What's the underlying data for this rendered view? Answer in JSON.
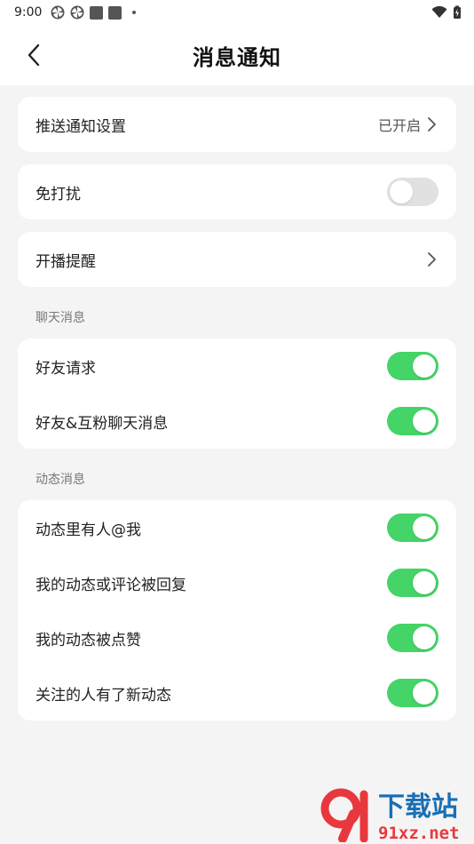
{
  "status_bar": {
    "time": "9:00"
  },
  "header": {
    "title": "消息通知"
  },
  "settings": {
    "push_label": "推送通知设置",
    "push_value": "已开启",
    "dnd_label": "免打扰",
    "dnd_on": false,
    "live_reminder_label": "开播提醒"
  },
  "chat_section": {
    "title": "聊天消息",
    "items": [
      {
        "label": "好友请求",
        "on": true
      },
      {
        "label": "好友&互粉聊天消息",
        "on": true
      }
    ]
  },
  "feed_section": {
    "title": "动态消息",
    "items": [
      {
        "label": "动态里有人@我",
        "on": true
      },
      {
        "label": "我的动态或评论被回复",
        "on": true
      },
      {
        "label": "我的动态被点赞",
        "on": true
      },
      {
        "label": "关注的人有了新动态",
        "on": true
      }
    ]
  },
  "colors": {
    "toggle_on": "#44d467",
    "toggle_off": "#e1e1e1",
    "watermark_red": "#e8383d",
    "watermark_blue": "#1a6fb5"
  },
  "watermark": {
    "brand": "下载站",
    "domain": "91xz.net"
  }
}
